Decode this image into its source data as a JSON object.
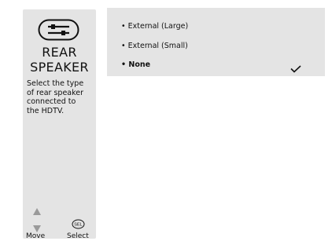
{
  "sidebar": {
    "icon": "tools-settings-icon",
    "title_line1": "REAR",
    "title_line2": "SPEAKER",
    "description": "Select the type\nof rear speaker\nconnected to\nthe HDTV.",
    "nav": {
      "up_icon": "up-arrow-icon",
      "down_icon": "down-arrow-icon",
      "move_label": "Move",
      "sel_icon_text": "SEL",
      "select_label": "Select"
    }
  },
  "options": [
    {
      "label": "• External (Large)",
      "selected": false
    },
    {
      "label": "• External (Small)",
      "selected": false
    },
    {
      "label": "• None",
      "selected": true
    }
  ],
  "selected_marker_icon": "checkmark-icon",
  "colors": {
    "panel_bg": "#e4e4e4",
    "text": "#111111",
    "arrow": "#9a9a9a"
  }
}
